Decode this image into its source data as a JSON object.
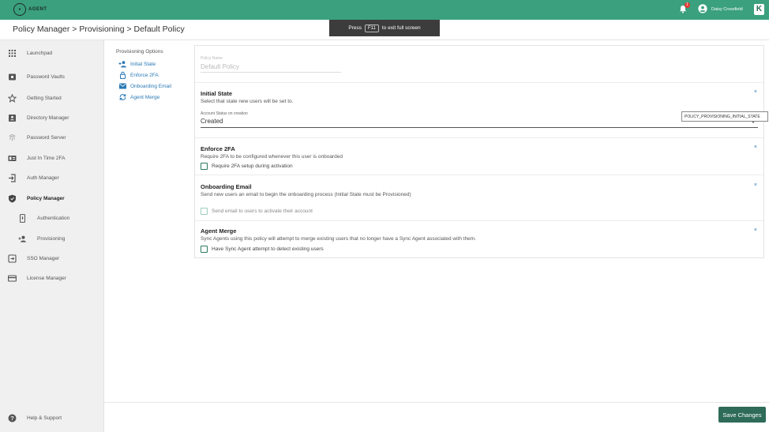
{
  "topbar": {
    "logo_text": "AGENT",
    "notification_count": "1",
    "user_name": "Daisy Crossfield",
    "k_button": "K"
  },
  "breadcrumb": "Policy Manager > Provisioning > Default Policy",
  "fullscreen_toast": {
    "before": "Press",
    "key": "F11",
    "after": "to exit full screen"
  },
  "sidebar": {
    "items": [
      {
        "label": "Launchpad",
        "icon": "grid-icon"
      },
      {
        "label": "Password Vaults",
        "icon": "vault-icon"
      },
      {
        "label": "Getting Started",
        "icon": "star-icon"
      },
      {
        "label": "Directory Manager",
        "icon": "contact-card-icon"
      },
      {
        "label": "Password Server",
        "icon": "fingerprint-icon"
      },
      {
        "label": "Just In Time 2FA",
        "icon": "badge-icon"
      },
      {
        "label": "Auth Manager",
        "icon": "login-icon"
      },
      {
        "label": "Policy Manager",
        "icon": "shield-icon"
      },
      {
        "label": "Authentication",
        "icon": "phone-icon"
      },
      {
        "label": "Provisioning",
        "icon": "add-user-icon"
      },
      {
        "label": "SSO Manager",
        "icon": "sso-icon"
      },
      {
        "label": "License Manager",
        "icon": "card-icon"
      }
    ],
    "help_label": "Help & Support"
  },
  "provisioning_options": {
    "title": "Provisioning Options",
    "links": [
      {
        "label": "Initial State",
        "icon": "add-user-icon"
      },
      {
        "label": "Enforce 2FA",
        "icon": "lock-icon"
      },
      {
        "label": "Onboarding Email",
        "icon": "email-icon"
      },
      {
        "label": "Agent Merge",
        "icon": "sync-icon"
      }
    ]
  },
  "form": {
    "policy_name_label": "Policy Name",
    "policy_name_value": "Default Policy",
    "initial_state": {
      "title": "Initial State",
      "description": "Select that state new users will be set to.",
      "select_label": "Account Status on creation",
      "select_value": "Created",
      "tooltip": "POLICY_PROVISIONING_INITIAL_STATE"
    },
    "enforce_2fa": {
      "title": "Enforce 2FA",
      "description": "Require 2FA to be configured whenever this user is onboarded",
      "checkbox_label": "Require 2FA setup during activation"
    },
    "onboarding_email": {
      "title": "Onboarding Email",
      "description": "Send new users an email to begin the onboarding process (Initial State must be Provisioned)",
      "checkbox_label": "Send email to users to activate their account"
    },
    "agent_merge": {
      "title": "Agent Merge",
      "description": "Sync Agents using this policy will attempt to merge existing users that no longer have a Sync Agent associated with them.",
      "checkbox_label": "Have Sync Agent attempt to detect existing users"
    },
    "close_glyph": "×"
  },
  "save_button": "Save Changes",
  "colors": {
    "topbar": "#3aa07e",
    "accent_link": "#2b79b5",
    "save_button": "#2e6b58"
  }
}
